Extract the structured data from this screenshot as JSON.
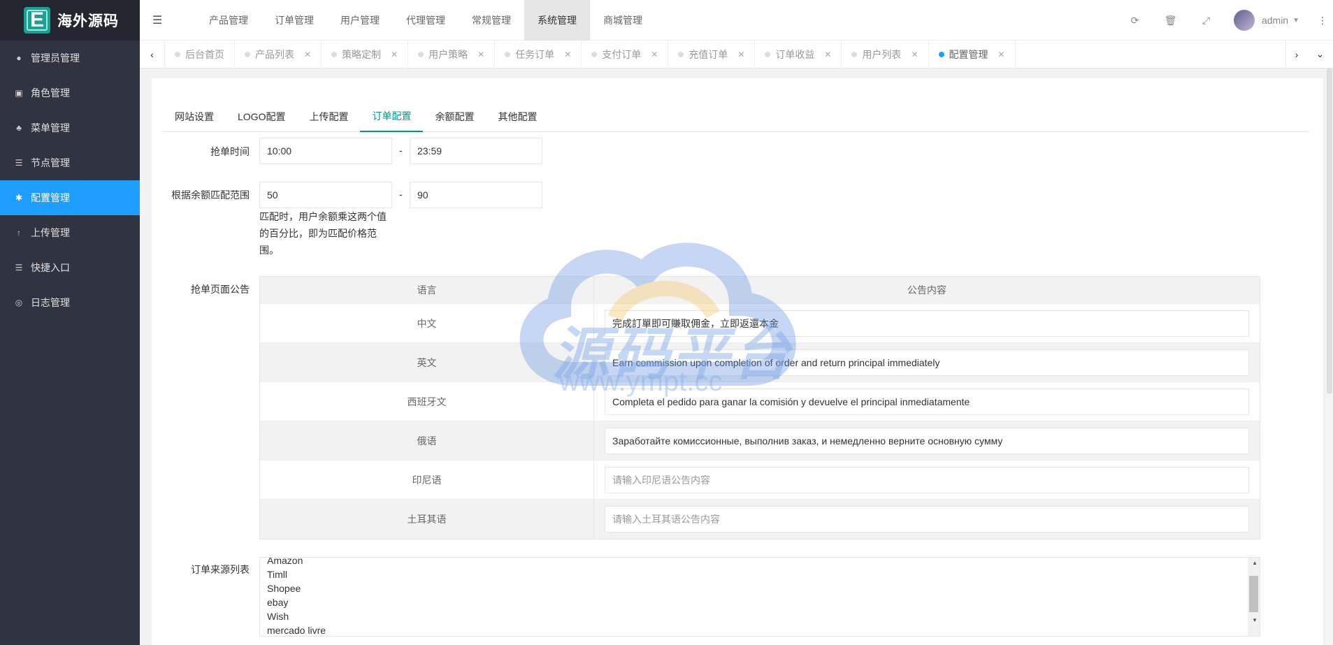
{
  "brand": {
    "logo_letter": "E",
    "title": "海外源码"
  },
  "sidebar": {
    "items": [
      {
        "label": "管理员管理",
        "icon": "user-icon"
      },
      {
        "label": "角色管理",
        "icon": "role-icon"
      },
      {
        "label": "菜单管理",
        "icon": "tree-icon"
      },
      {
        "label": "节点管理",
        "icon": "list-icon"
      },
      {
        "label": "配置管理",
        "icon": "gear-icon",
        "active": true
      },
      {
        "label": "上传管理",
        "icon": "upload-icon"
      },
      {
        "label": "快捷入口",
        "icon": "list-icon"
      },
      {
        "label": "日志管理",
        "icon": "log-icon"
      }
    ]
  },
  "header": {
    "menu": [
      "产品管理",
      "订单管理",
      "用户管理",
      "代理管理",
      "常规管理",
      "系统管理",
      "商城管理"
    ],
    "active_menu": "系统管理",
    "user": "admin"
  },
  "tabs": {
    "items": [
      "后台首页",
      "产品列表",
      "策略定制",
      "用户策略",
      "任务订单",
      "支付订单",
      "充值订单",
      "订单收益",
      "用户列表",
      "配置管理"
    ],
    "active": "配置管理"
  },
  "form_tabs": {
    "items": [
      "网站设置",
      "LOGO配置",
      "上传配置",
      "订单配置",
      "余额配置",
      "其他配置"
    ],
    "active": "订单配置"
  },
  "form": {
    "grab_time": {
      "label": "抢单时间",
      "start": "10:00",
      "end": "23:59",
      "sep": "-"
    },
    "balance_range": {
      "label": "根据余额匹配范围",
      "min": "50",
      "max": "90",
      "sep": "-",
      "hint": "匹配时，用户余额乘这两个值的百分比，即为匹配价格范围。"
    },
    "announcement": {
      "label": "抢单页面公告",
      "col_lang": "语言",
      "col_content": "公告内容",
      "rows": [
        {
          "lang": "中文",
          "value": "完成訂單即可賺取佣金，立即返還本金",
          "placeholder": ""
        },
        {
          "lang": "英文",
          "value": "Earn commission upon completion of order and return principal immediately",
          "placeholder": ""
        },
        {
          "lang": "西班牙文",
          "value": "Completa el pedido para ganar la comisión y devuelve el principal inmediatamente",
          "placeholder": ""
        },
        {
          "lang": "俄语",
          "value": "Заработайте комиссионные, выполнив заказ, и немедленно верните основную сумму",
          "placeholder": ""
        },
        {
          "lang": "印尼语",
          "value": "",
          "placeholder": "请输入印尼语公告内容"
        },
        {
          "lang": "土耳其语",
          "value": "",
          "placeholder": "请输入土耳其语公告内容"
        }
      ]
    },
    "order_sources": {
      "label": "订单来源列表",
      "lines": [
        "Amazon",
        "Timll",
        "Shopee",
        "ebay",
        "Wish",
        "mercado livre"
      ]
    }
  },
  "watermark": {
    "text": "源码平台",
    "url": "www.ympt.cc"
  },
  "colors": {
    "sidebar_bg": "#2f3440",
    "active_nav": "#1e9fff",
    "active_tab": "#009688"
  }
}
